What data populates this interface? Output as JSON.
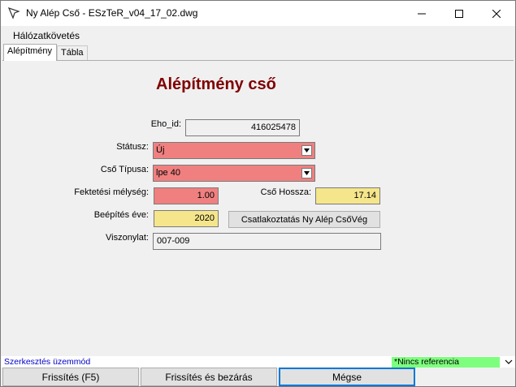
{
  "window": {
    "title": "Ny Alép Cső - ESzTeR_v04_17_02.dwg"
  },
  "menu": {
    "item": "Hálózatkövetés"
  },
  "tabs": [
    {
      "label": "Alépítmény"
    },
    {
      "label": "Tábla"
    }
  ],
  "form": {
    "heading": "Alépítmény cső",
    "eho_id": {
      "label": "Eho_id:",
      "value": "416025478"
    },
    "status": {
      "label": "Státusz:",
      "value": "Új"
    },
    "pipe_type": {
      "label": "Cső Típusa:",
      "value": "lpe 40"
    },
    "depth": {
      "label": "Fektetési mélység:",
      "value": "1.00"
    },
    "pipe_length": {
      "label": "Cső Hossza:",
      "value": "17.14"
    },
    "install_year": {
      "label": "Beépítés éve:",
      "value": "2020"
    },
    "connect_button": "Csatlakoztatás Ny Alép CsőVég",
    "relation": {
      "label": "Viszonylat:",
      "value": "007-009"
    }
  },
  "status_bar": {
    "mode": "Szerkesztés üzemmód",
    "reference": "*Nincs referencia"
  },
  "buttons": {
    "refresh": "Frissítés (F5)",
    "refresh_close": "Frissítés és bezárás",
    "cancel": "Mégse"
  },
  "colors": {
    "heading": "#7f0000",
    "required_field": "#f08080",
    "calc_field": "#f5e68c",
    "status_mode": "#0000c8",
    "reference_bg": "#7dff7d",
    "focus_border": "#0078d7"
  }
}
